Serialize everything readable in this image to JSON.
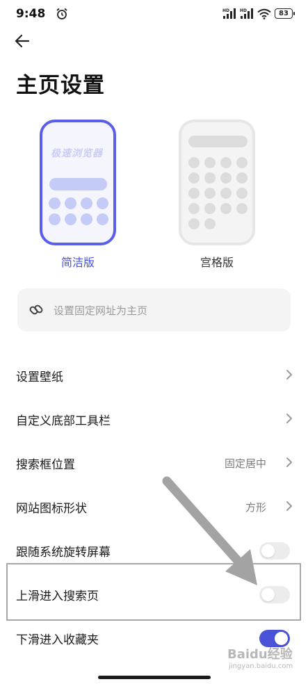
{
  "status_bar": {
    "time": "9:48",
    "signal_label_1": "HD",
    "signal_label_2": "HD",
    "battery": "83"
  },
  "page": {
    "title": "主页设置"
  },
  "layout_options": [
    {
      "label": "简洁版",
      "brand_text": "极速浏览器",
      "selected": true
    },
    {
      "label": "宫格版",
      "selected": false
    }
  ],
  "url_input": {
    "placeholder": "设置固定网址为主页"
  },
  "settings": {
    "wallpaper": {
      "label": "设置壁纸"
    },
    "toolbar": {
      "label": "自定义底部工具栏"
    },
    "search_position": {
      "label": "搜索框位置",
      "value": "固定居中"
    },
    "icon_shape": {
      "label": "网站图标形状",
      "value": "方形"
    },
    "rotate": {
      "label": "跟随系统旋转屏幕",
      "on": false
    },
    "swipe_up": {
      "label": "上滑进入搜索页",
      "on": false
    },
    "swipe_down": {
      "label": "下滑进入收藏夹",
      "on": true
    }
  },
  "watermark": {
    "logo": "Baidu经验",
    "sub": "jingyan.baidu.com"
  },
  "colors": {
    "accent": "#4a52d8",
    "toggle_off": "#ececec",
    "annotation_gray": "#a7a7a7"
  }
}
